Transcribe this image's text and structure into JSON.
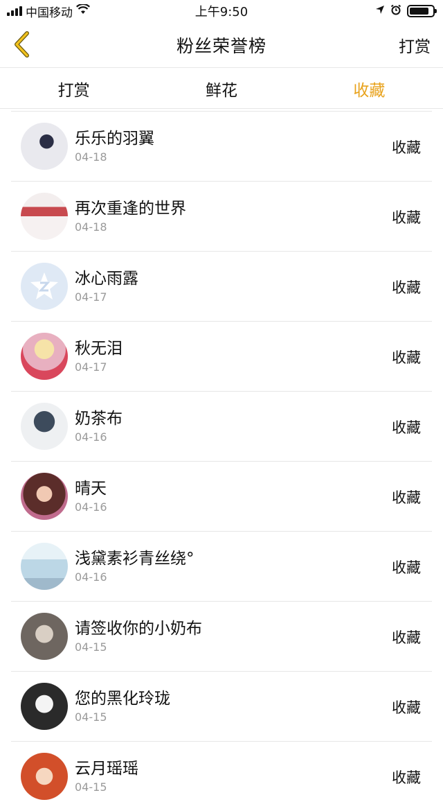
{
  "status_bar": {
    "carrier": "中国移动",
    "time": "上午9:50"
  },
  "nav": {
    "back_icon": "chevron-left-icon",
    "title": "粉丝荣誉榜",
    "action_label": "打赏",
    "accent_color": "#e8a21c"
  },
  "tabs": [
    {
      "label": "打赏",
      "active": false
    },
    {
      "label": "鲜花",
      "active": false
    },
    {
      "label": "收藏",
      "active": true
    }
  ],
  "list": {
    "items": [
      {
        "name": "乐乐的羽翼",
        "date": "04-18",
        "action": "收藏"
      },
      {
        "name": "再次重逢的世界",
        "date": "04-18",
        "action": "收藏"
      },
      {
        "name": "冰心雨露",
        "date": "04-17",
        "action": "收藏"
      },
      {
        "name": "秋无泪",
        "date": "04-17",
        "action": "收藏"
      },
      {
        "name": "奶茶布",
        "date": "04-16",
        "action": "收藏"
      },
      {
        "name": "晴天",
        "date": "04-16",
        "action": "收藏"
      },
      {
        "name": "浅黛素衫青丝绕°",
        "date": "04-16",
        "action": "收藏"
      },
      {
        "name": "请签收你的小奶布",
        "date": "04-15",
        "action": "收藏"
      },
      {
        "name": "您的黑化玲珑",
        "date": "04-15",
        "action": "收藏"
      },
      {
        "name": "云月瑶瑶",
        "date": "04-15",
        "action": "收藏"
      }
    ]
  }
}
